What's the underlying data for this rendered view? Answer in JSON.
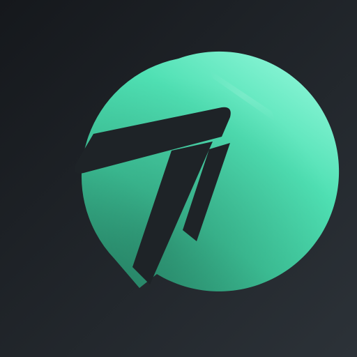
{
  "icon": {
    "background_colors": [
      "#15181c",
      "#2c3238"
    ],
    "badge_colors": {
      "highlight": "#8af5d6",
      "mid": "#4fe0b3",
      "base": "#3fc89c",
      "shadow": "#2f9d7a"
    },
    "glyph_color": "#1e2327",
    "logo_icon_name": "stylized-7-speech-bubble-logo-icon"
  }
}
